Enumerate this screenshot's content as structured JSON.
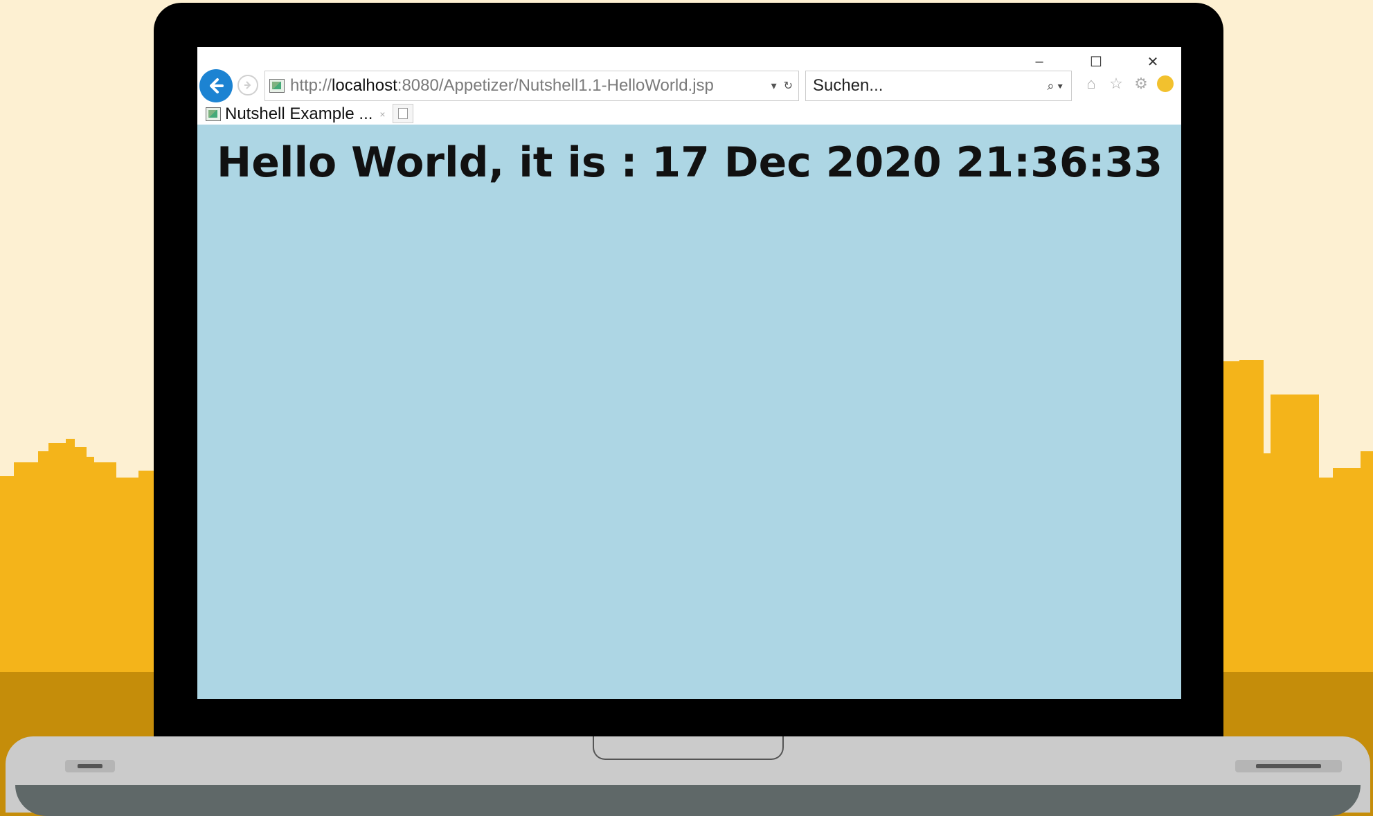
{
  "browser": {
    "address_url_prefix": "http://",
    "address_host": "localhost",
    "address_url_rest": ":8080/Appetizer/Nutshell1.1-HelloWorld.jsp",
    "address_dropdown": "▾",
    "refresh_icon": "↻",
    "search_placeholder": "Suchen...",
    "search_icon": "⌕ ▾",
    "tab_title": "Nutshell Example ...",
    "tab_close": "×",
    "window_controls": {
      "minimize": "–",
      "maximize": "☐",
      "close": "✕"
    },
    "icons": {
      "home": "⌂",
      "star": "☆",
      "settings": "⚙"
    }
  },
  "page": {
    "heading": "Hello World, it is : 17 Dec 2020 21:36:33"
  },
  "colors": {
    "page_background": "#ADD6E4",
    "scene_background": "#FDF0D2",
    "skyline": "#F4B41A",
    "ground": "#C58D0A",
    "back_button": "#1C83D2"
  }
}
